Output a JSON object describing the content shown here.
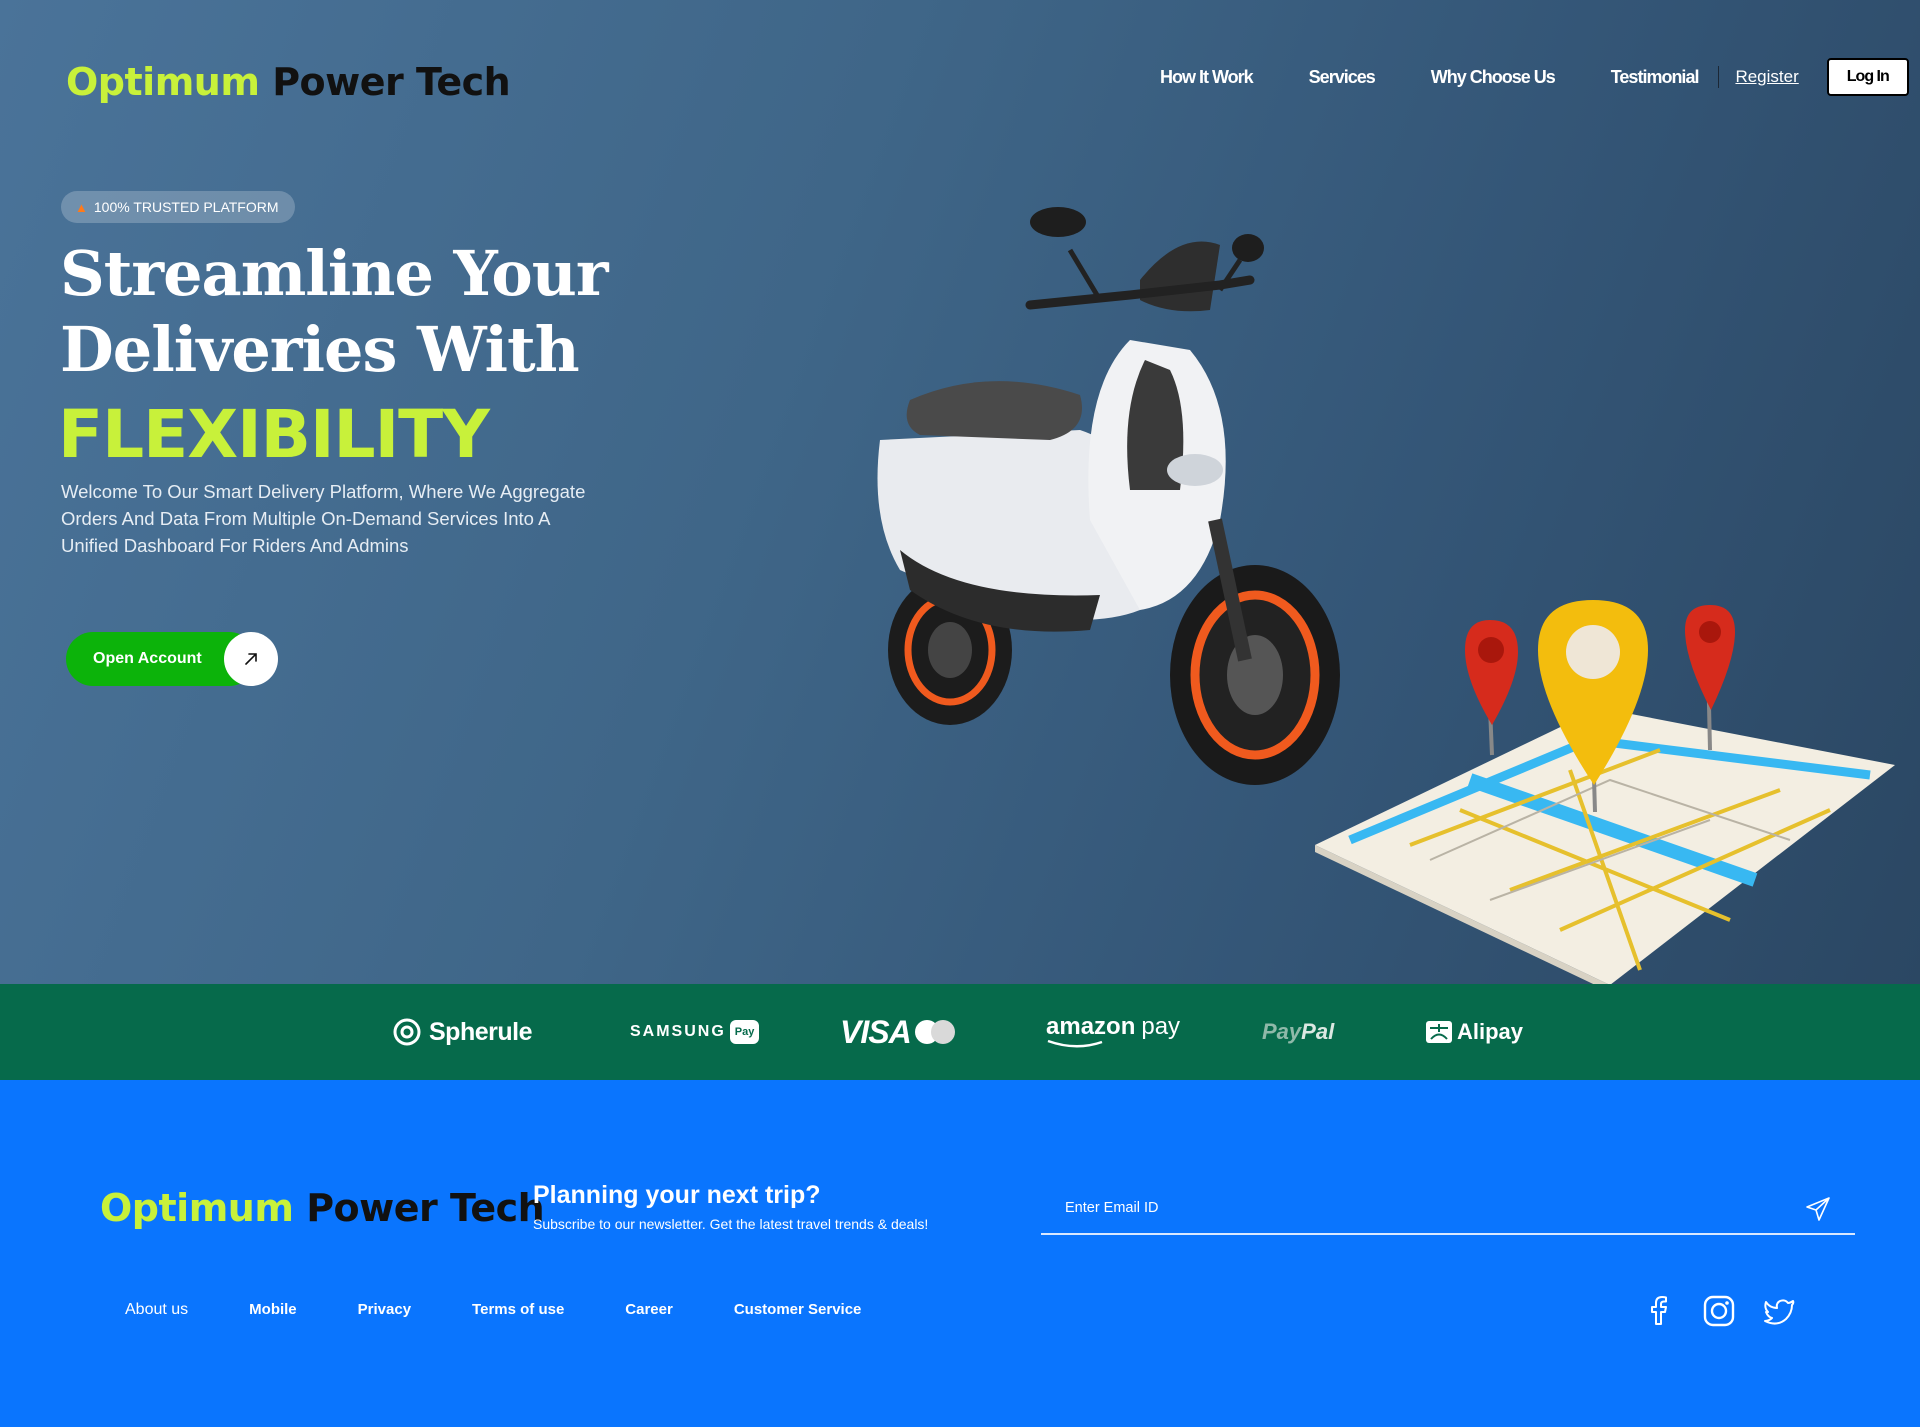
{
  "brand": {
    "part1": "Optimum",
    "part2": "Power Tech"
  },
  "nav": {
    "links": [
      "How It Work",
      "Services",
      "Why Choose Us",
      "Testimonial"
    ],
    "register": "Register",
    "login": "Log In"
  },
  "hero": {
    "badge": "100% TRUSTED PLATFORM",
    "title_line1": "Streamline Your",
    "title_line2": "Deliveries With",
    "title_accent": "FLEXIBILITY",
    "description": "Welcome To Our Smart Delivery Platform, Where We Aggregate Orders And Data From Multiple On-Demand Services Into A Unified Dashboard For Riders And Admins",
    "cta_label": "Open Account"
  },
  "partners": {
    "spherule": "Spherule",
    "samsung": "SAMSUNG",
    "samsung_pay": "Pay",
    "visa": "VISA",
    "amazon_1": "amazon",
    "amazon_2": "pay",
    "paypal_1": "Pay",
    "paypal_2": "Pal",
    "alipay": "Alipay"
  },
  "footer": {
    "newsletter_title": "Planning your next trip?",
    "newsletter_subtitle": "Subscribe to our newsletter. Get the latest travel trends & deals!",
    "email_placeholder": "Enter Email ID",
    "links": [
      "About us",
      "Mobile",
      "Privacy",
      "Terms of use",
      "Career",
      "Customer Service"
    ],
    "social_icons": [
      "facebook-icon",
      "instagram-icon",
      "twitter-icon"
    ]
  },
  "colors": {
    "accent_lime": "#c8f13a",
    "cta_green": "#0cb30a",
    "partner_strip": "#066a4b",
    "footer_blue": "#0a75fe"
  }
}
